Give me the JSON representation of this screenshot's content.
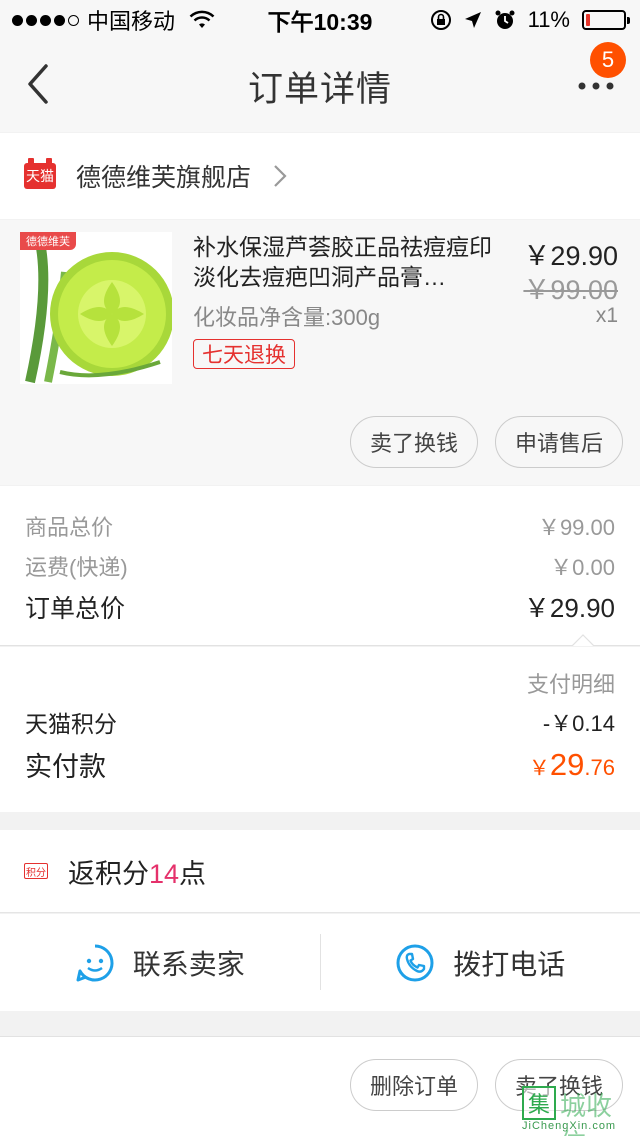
{
  "status_bar": {
    "carrier": "中国移动",
    "time": "下午10:39",
    "battery": "11%",
    "battery_level": 0.11
  },
  "nav": {
    "title": "订单详情",
    "badge_count": "5"
  },
  "store": {
    "logo_text": "天猫",
    "name": "德德维芙旗舰店"
  },
  "product": {
    "image_tag": "德德维芙",
    "title": "补水保湿芦荟胶正品祛痘痘印淡化去痘疤凹洞产品膏…",
    "spec": "化妆品净含量:300g",
    "tag": "七天退换",
    "price": "￥29.90",
    "original_price": "￥99.00",
    "quantity": "x1",
    "actions": {
      "sell": "卖了换钱",
      "after_sale": "申请售后"
    }
  },
  "totals": {
    "goods_label": "商品总价",
    "goods_value": "￥99.00",
    "shipping_label": "运费(快递)",
    "shipping_value": "￥0.00",
    "order_label": "订单总价",
    "order_value": "￥29.90"
  },
  "payment": {
    "detail_link": "支付明细",
    "points_label": "天猫积分",
    "points_value": "-￥0.14",
    "paid_label": "实付款",
    "paid_currency": "￥",
    "paid_int": "29",
    "paid_dec": ".76"
  },
  "rebate": {
    "icon_text": "积分",
    "prefix": "返积分",
    "amount": "14",
    "suffix": "点"
  },
  "contact": {
    "seller": "联系卖家",
    "phone": "拨打电话"
  },
  "bottom": {
    "delete": "删除订单",
    "sell": "卖了换钱"
  },
  "watermark": {
    "icon_text": "集",
    "text": "城收信",
    "url": "JiChengXin.com"
  },
  "colors": {
    "accent": "#ff5000",
    "tmall_red": "#e5312f",
    "icon_blue": "#1ea0e8"
  }
}
